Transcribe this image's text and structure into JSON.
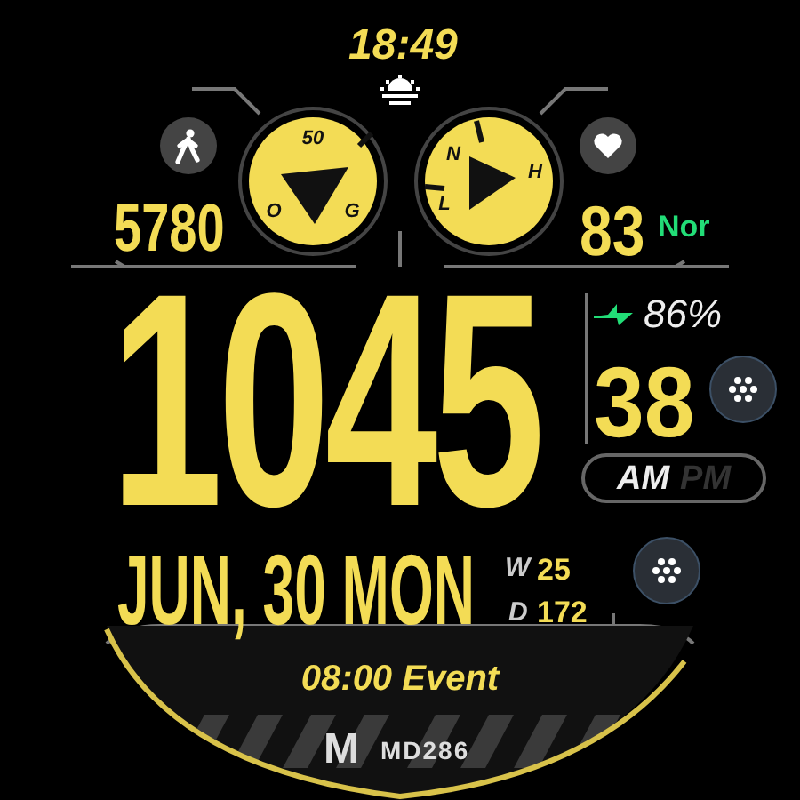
{
  "sunset_time": "18:49",
  "steps": {
    "value": "5780"
  },
  "left_gauge": {
    "labels": [
      "50",
      "O",
      "G"
    ]
  },
  "right_gauge": {
    "labels": [
      "N",
      "H",
      "L"
    ]
  },
  "heart_rate": {
    "value": "83",
    "status": "Nor"
  },
  "time": {
    "hours": "10",
    "minutes": "45",
    "seconds": "38"
  },
  "battery": {
    "value": "86%",
    "charging": true
  },
  "am_pm": [
    {
      "label": "AM",
      "selected": true
    },
    {
      "label": "PM",
      "selected": false
    }
  ],
  "date": "JUN, 30 MON",
  "week": {
    "label": "W",
    "value": "25"
  },
  "day_of_year": {
    "label": "D",
    "value": "172"
  },
  "event": "08:00 Event",
  "brand": {
    "logo": "M",
    "name": "MD286"
  }
}
